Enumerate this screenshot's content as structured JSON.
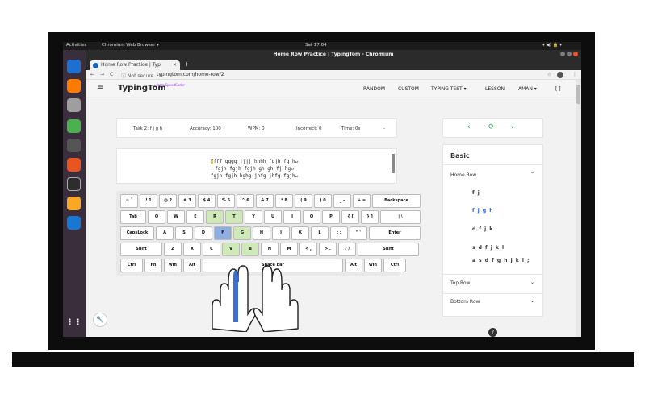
{
  "os": {
    "activities": "Activities",
    "app_name": "Chromium Web Browser ▾",
    "clock": "Sat 17:04",
    "tray": "▾ ◀) 🔒 ▾"
  },
  "window": {
    "title": "Home Row Practice | TypingTom - Chromium"
  },
  "browser": {
    "tab_label": "Home Row Practice | Typi",
    "tab_close": "×",
    "new_tab": "+",
    "back": "←",
    "forward": "→",
    "reload": "C",
    "security": "ⓘ Not secure",
    "url": "typingtom.com/home-row/2",
    "star": "☆",
    "more": "⋮"
  },
  "app": {
    "logo": "TypingTom",
    "logo_sub": "from SpeedCoder",
    "nav": [
      "RANDOM",
      "CUSTOM",
      "TYPING TEST ▾",
      "LESSON",
      "AMAN ▾",
      "[ ]"
    ]
  },
  "stats": {
    "task": "Task 2: f j g h",
    "accuracy": "Accuracy: 100",
    "wpm": "WPM: 0",
    "incorrect": "Incorrect: 0",
    "time": "Time: 0s",
    "dash": "-"
  },
  "text": {
    "cursor": "f",
    "line1_rest": "fff gggg jjjj hhhh fgjh fgjh↵",
    "line2": "fgjh fgjh fgjh gh gh fj hg↵",
    "line3": "fgjh fgjh hghg jhfg jhfg fgjh↵"
  },
  "keyboard": {
    "rows": [
      [
        [
          "~\n`",
          0
        ],
        [
          "!\n1",
          0
        ],
        [
          "@\n2",
          0
        ],
        [
          "#\n3",
          0
        ],
        [
          "$\n4",
          0
        ],
        [
          "%\n5",
          0
        ],
        [
          "^\n6",
          0
        ],
        [
          "&\n7",
          0
        ],
        [
          "*\n8",
          0
        ],
        [
          "(\n9",
          0
        ],
        [
          ")\n0",
          0
        ],
        [
          "_\n-",
          0
        ],
        [
          "+\n=",
          0
        ],
        [
          "Backspace",
          0
        ]
      ],
      [
        [
          "Tab",
          0
        ],
        [
          "Q",
          0
        ],
        [
          "W",
          0
        ],
        [
          "E",
          0
        ],
        [
          "R",
          1
        ],
        [
          "T",
          1
        ],
        [
          "Y",
          0
        ],
        [
          "U",
          0
        ],
        [
          "I",
          0
        ],
        [
          "O",
          0
        ],
        [
          "P",
          0
        ],
        [
          "{\n[",
          0
        ],
        [
          "}\n]",
          0
        ],
        [
          "|\n\\",
          0
        ]
      ],
      [
        [
          "CapsLock",
          0
        ],
        [
          "A",
          0
        ],
        [
          "S",
          0
        ],
        [
          "D",
          0
        ],
        [
          "F",
          2
        ],
        [
          "G",
          1
        ],
        [
          "H",
          0
        ],
        [
          "J",
          0
        ],
        [
          "K",
          0
        ],
        [
          "L",
          0
        ],
        [
          ":\n;",
          0
        ],
        [
          "\"\n'",
          0
        ],
        [
          "Enter",
          0
        ]
      ],
      [
        [
          "Shift",
          0
        ],
        [
          "Z",
          0
        ],
        [
          "X",
          0
        ],
        [
          "C",
          0
        ],
        [
          "V",
          1
        ],
        [
          "B",
          1
        ],
        [
          "N",
          0
        ],
        [
          "M",
          0
        ],
        [
          "<\n,",
          0
        ],
        [
          ">\n.",
          0
        ],
        [
          "?\n/",
          0
        ],
        [
          "Shift",
          0
        ]
      ],
      [
        [
          "Ctrl",
          0
        ],
        [
          "Fn",
          0
        ],
        [
          "win",
          0
        ],
        [
          "Alt",
          0
        ],
        [
          "Space bar",
          0
        ],
        [
          "Alt",
          0
        ],
        [
          "win",
          0
        ],
        [
          "Ctrl",
          0
        ]
      ]
    ]
  },
  "lesson_nav": {
    "prev": "‹",
    "repeat": "⟳",
    "next": "›"
  },
  "lessons": {
    "header": "Basic",
    "section_home": "Home Row",
    "items": [
      "f j",
      "f j g h",
      "d f j k",
      "s d f j k l",
      "a s d f g h j k l ;"
    ],
    "active_index": 1,
    "section_top": "Top Row",
    "section_bottom": "Bottom Row",
    "chev_up": "⌃",
    "chev_down": "⌄"
  },
  "misc": {
    "wrench": "🔧",
    "help": "?"
  },
  "colors": {
    "accent_green": "#1aa34a",
    "active_blue": "#1e63d6",
    "highlight_green": "#cfe9b8",
    "highlight_blue": "#8eaee0"
  }
}
